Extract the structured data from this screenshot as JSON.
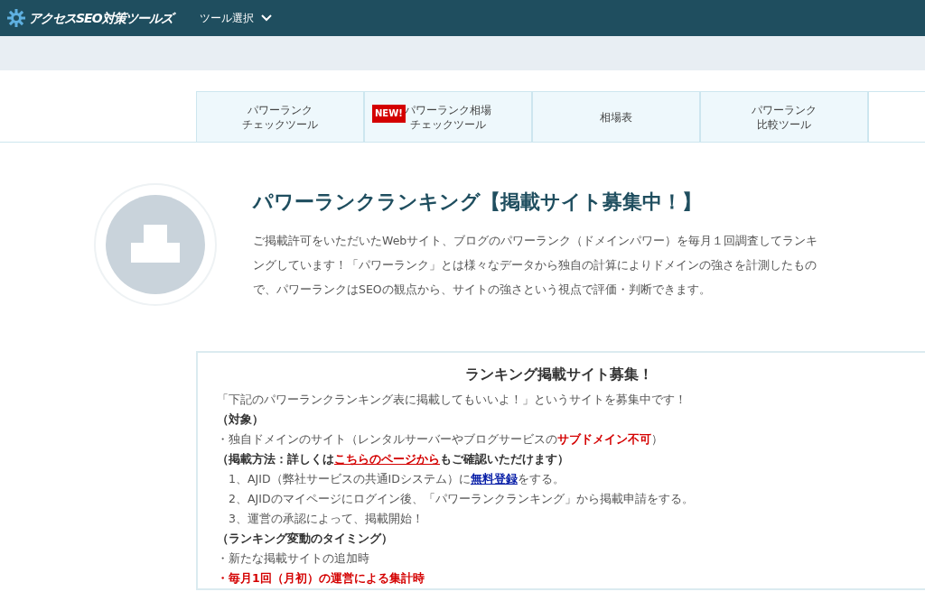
{
  "header": {
    "logo_text": "アクセスSEO対策ツールズ",
    "menu_label": "ツール選択"
  },
  "tabs": [
    {
      "lines": [
        "パワーランク",
        "チェックツール"
      ],
      "selected": false
    },
    {
      "lines": [
        "パワーランク相場",
        "チェックツール"
      ],
      "badge": "NEW!",
      "selected": false
    },
    {
      "lines": [
        "相場表"
      ],
      "selected": false
    },
    {
      "lines": [
        "パワーランク",
        "比較ツール"
      ],
      "selected": false
    },
    {
      "selected": true
    }
  ],
  "intro": {
    "title": "パワーランクランキング【掲載サイト募集中！】",
    "lines": [
      "ご掲載許可をいただいたWebサイト、ブログのパワーランク（ドメインパワー）を毎月１回調査してランキ",
      "ングしています！「パワーランク」とは様々なデータから独自の計算によりドメインの強さを計測したもの",
      "で、パワーランクはSEOの観点から、サイトの強さという視点で評価・判断できます。"
    ]
  },
  "recruit": {
    "title": "ランキング掲載サイト募集！",
    "lines": [
      {
        "kind": "plain",
        "parts": [
          {
            "kind": "text",
            "text": "「下記のパワーランクランキング表に掲載してもいいよ！」というサイトを募集中です！"
          }
        ]
      },
      {
        "kind": "bold",
        "parts": [
          {
            "kind": "text",
            "text": "（対象）"
          }
        ]
      },
      {
        "kind": "plain",
        "parts": [
          {
            "kind": "text",
            "text": "・独自ドメインのサイト（レンタルサーバーやブログサービスの"
          },
          {
            "kind": "red",
            "text": "サブドメイン不可"
          },
          {
            "kind": "text",
            "text": "）"
          }
        ]
      },
      {
        "kind": "bold",
        "parts": [
          {
            "kind": "text",
            "text": "（掲載方法：詳しくは"
          },
          {
            "kind": "link",
            "text": "こちらのページから"
          },
          {
            "kind": "text",
            "text": "もご確認いただけます）"
          }
        ]
      },
      {
        "kind": "step",
        "parts": [
          {
            "kind": "text",
            "text": "1、AJID（弊社サービスの共通IDシステム）に"
          },
          {
            "kind": "blue-link",
            "text": "無料登録"
          },
          {
            "kind": "text",
            "text": "をする。"
          }
        ]
      },
      {
        "kind": "step",
        "parts": [
          {
            "kind": "text",
            "text": "2、AJIDのマイページにログイン後、「パワーランクランキング」から掲載申請をする。"
          }
        ]
      },
      {
        "kind": "step",
        "parts": [
          {
            "kind": "text",
            "text": "3、運営の承認によって、掲載開始！"
          }
        ]
      },
      {
        "kind": "bold",
        "parts": [
          {
            "kind": "text",
            "text": "（ランキング変動のタイミング）"
          }
        ]
      },
      {
        "kind": "plain",
        "parts": [
          {
            "kind": "text",
            "text": "・新たな掲載サイトの追加時"
          }
        ]
      },
      {
        "kind": "alert",
        "parts": [
          {
            "kind": "text",
            "text": "・毎月1回（月初）の運営による集計時"
          }
        ]
      }
    ]
  }
}
